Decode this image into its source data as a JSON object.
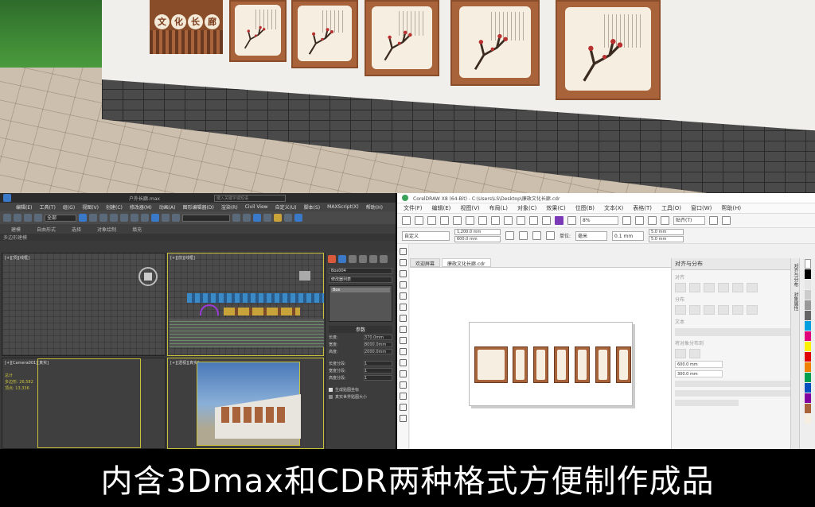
{
  "scene": {
    "title_board_chars": [
      "文",
      "化",
      "长",
      "廊"
    ]
  },
  "max": {
    "window_title": "户外长廊.max",
    "search_placeholder": "键入关键字或短语",
    "menu": [
      "编辑(E)",
      "工具(T)",
      "组(G)",
      "视图(V)",
      "创建(C)",
      "修改器(M)",
      "动画(A)",
      "图形编辑器(D)",
      "渲染(R)",
      "Civil View",
      "自定义(U)",
      "脚本(S)",
      "MAXScript(X)",
      "帮助(H)"
    ],
    "view_dropdown": "全部",
    "ribbon": [
      "建模",
      "自由形式",
      "选择",
      "对象绘制",
      "填充"
    ],
    "subtitle": "多边形建模",
    "viewports": {
      "top_left": "[+][顶][线框]",
      "top_right": "[+][前][线框]",
      "bottom_left": "[+][Camera001][真实]",
      "bottom_right": "[+][透视][真实]"
    },
    "viewport_stats": [
      "总计",
      "多边形:  26,582",
      "顶点:    13,336"
    ],
    "command_panel": {
      "object_name": "Box004",
      "object_type_label": "修改器列表",
      "stack_item": "Box",
      "params_header": "参数",
      "params": [
        {
          "label": "长度:",
          "value": "370.0mm"
        },
        {
          "label": "宽度:",
          "value": "8000.0mm"
        },
        {
          "label": "高度:",
          "value": "2000.0mm"
        },
        {
          "label": "长度分段:",
          "value": "1"
        },
        {
          "label": "宽度分段:",
          "value": "1"
        },
        {
          "label": "高度分段:",
          "value": "1"
        }
      ],
      "checkbox_1": "生成贴图坐标",
      "checkbox_2": "真实世界贴图大小"
    }
  },
  "cdr": {
    "window_title": "CorelDRAW X8 (64-Bit) - C:\\Users\\LS\\Desktop\\廉政文化长廊.cdr",
    "menu": [
      "文件(F)",
      "编辑(E)",
      "视图(V)",
      "布局(L)",
      "对象(C)",
      "效果(C)",
      "位图(B)",
      "文本(X)",
      "表格(T)",
      "工具(O)",
      "窗口(W)",
      "帮助(H)"
    ],
    "zoom": "8%",
    "paste_label": "贴齐(T)",
    "page_preset": "自定义",
    "width_value": "1,200.0 mm",
    "height_value": "600.0 mm",
    "unit_label": "单位:",
    "unit_value": "毫米",
    "nudge_value": "0.1 mm",
    "dup_x": "5.0 mm",
    "dup_y": "5.0 mm",
    "tabs": [
      "欢迎屏幕",
      "廉政文化长廊.cdr"
    ],
    "docker_title": "对齐与分布",
    "docker": {
      "align_label": "对齐",
      "distribute_label": "分布",
      "text_label": "文本",
      "spacing_label": "将对象分布到",
      "x_value": "600.0 mm",
      "y_value": "300.0 mm"
    },
    "vertical_tabs": [
      "对齐与分布",
      "对象属性"
    ]
  },
  "caption": "内含3Dmax和CDR两种格式方便制作成品",
  "colors": {
    "wood": "#a8633a",
    "paper": "#f6efe1",
    "max_bg": "#3a3a3a",
    "cdr_bg": "#f0f0f0"
  }
}
